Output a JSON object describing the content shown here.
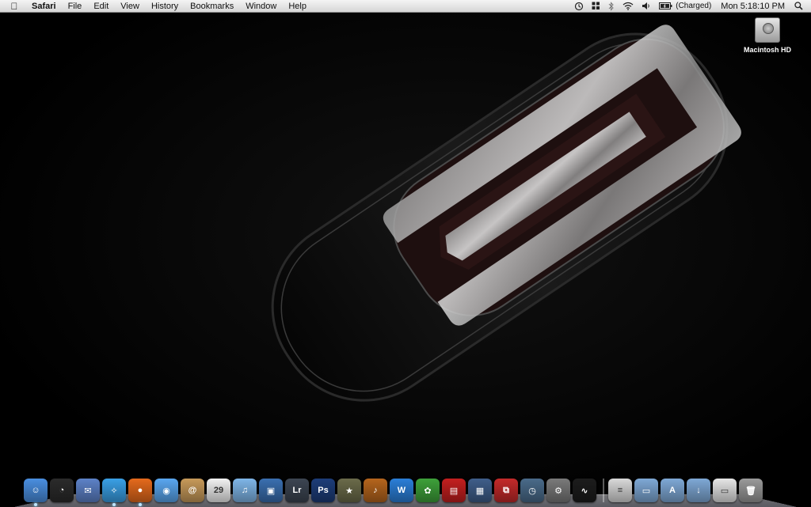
{
  "menubar": {
    "app_name": "Safari",
    "menus": [
      "File",
      "Edit",
      "View",
      "History",
      "Bookmarks",
      "Window",
      "Help"
    ],
    "battery_status": "(Charged)",
    "clock": "Mon 5:18:10 PM"
  },
  "desktop": {
    "icons": [
      {
        "label": "Macintosh HD",
        "icon": "hard-drive-icon"
      }
    ]
  },
  "dock": {
    "apps": [
      {
        "name": "finder",
        "icon": "finder-icon",
        "color": "#4a8fe0",
        "glyph": "☺"
      },
      {
        "name": "dashboard",
        "icon": "dashboard-icon",
        "color": "#2b2b2b",
        "glyph": "◔"
      },
      {
        "name": "mail",
        "icon": "mail-icon",
        "color": "#5d82c8",
        "glyph": "✉"
      },
      {
        "name": "safari",
        "icon": "safari-icon",
        "color": "#3aa0e6",
        "glyph": "✧"
      },
      {
        "name": "firefox",
        "icon": "firefox-icon",
        "color": "#e56a1c",
        "glyph": "●"
      },
      {
        "name": "ichat",
        "icon": "ichat-icon",
        "color": "#5aa7f0",
        "glyph": "◉"
      },
      {
        "name": "address-book",
        "icon": "address-book-icon",
        "color": "#c79a5a",
        "glyph": "@"
      },
      {
        "name": "ical",
        "icon": "ical-icon",
        "color": "#f2f2f2",
        "glyph": "29"
      },
      {
        "name": "itunes",
        "icon": "itunes-icon",
        "color": "#7fb6e8",
        "glyph": "♫"
      },
      {
        "name": "iphoto",
        "icon": "iphoto-icon",
        "color": "#3a6fb0",
        "glyph": "▣"
      },
      {
        "name": "lightroom",
        "icon": "lightroom-icon",
        "color": "#3c4552",
        "glyph": "Lr"
      },
      {
        "name": "photoshop",
        "icon": "photoshop-icon",
        "color": "#1d3d79",
        "glyph": "Ps"
      },
      {
        "name": "imovie",
        "icon": "imovie-icon",
        "color": "#6b6b4a",
        "glyph": "★"
      },
      {
        "name": "garageband",
        "icon": "garageband-icon",
        "color": "#b5651d",
        "glyph": "♪"
      },
      {
        "name": "iweb",
        "icon": "iweb-icon",
        "color": "#2b7fd8",
        "glyph": "W"
      },
      {
        "name": "frog-app",
        "icon": "frog-icon",
        "color": "#3ea13a",
        "glyph": "✿"
      },
      {
        "name": "photo-booth",
        "icon": "photo-booth-icon",
        "color": "#c41f1f",
        "glyph": "▤"
      },
      {
        "name": "spaces",
        "icon": "spaces-icon",
        "color": "#3f5e8a",
        "glyph": "▦"
      },
      {
        "name": "parallels",
        "icon": "parallels-icon",
        "color": "#c42a2a",
        "glyph": "⧉"
      },
      {
        "name": "time-machine",
        "icon": "time-machine-icon",
        "color": "#4a6b8a",
        "glyph": "◷"
      },
      {
        "name": "system-preferences",
        "icon": "system-preferences-icon",
        "color": "#7a7a7a",
        "glyph": "⚙"
      },
      {
        "name": "activity-monitor",
        "icon": "activity-monitor-icon",
        "color": "#1c1c1c",
        "glyph": "∿"
      }
    ],
    "stacks": [
      {
        "name": "document-stack",
        "icon": "document-stack-icon",
        "color": "#d9d9d9",
        "glyph": "≡"
      },
      {
        "name": "documents-folder",
        "icon": "documents-folder-icon",
        "color": "#7fa9d6",
        "glyph": "▭"
      },
      {
        "name": "applications-folder",
        "icon": "applications-folder-icon",
        "color": "#7fa9d6",
        "glyph": "A"
      },
      {
        "name": "downloads-folder",
        "icon": "downloads-folder-icon",
        "color": "#7fa9d6",
        "glyph": "↓"
      },
      {
        "name": "screenshot-stack",
        "icon": "screenshot-stack-icon",
        "color": "#e6e6e6",
        "glyph": "▭"
      },
      {
        "name": "trash",
        "icon": "trash-icon",
        "color": "#9a9a9a",
        "glyph": "🗑"
      }
    ],
    "running": [
      "finder",
      "safari",
      "firefox"
    ]
  }
}
